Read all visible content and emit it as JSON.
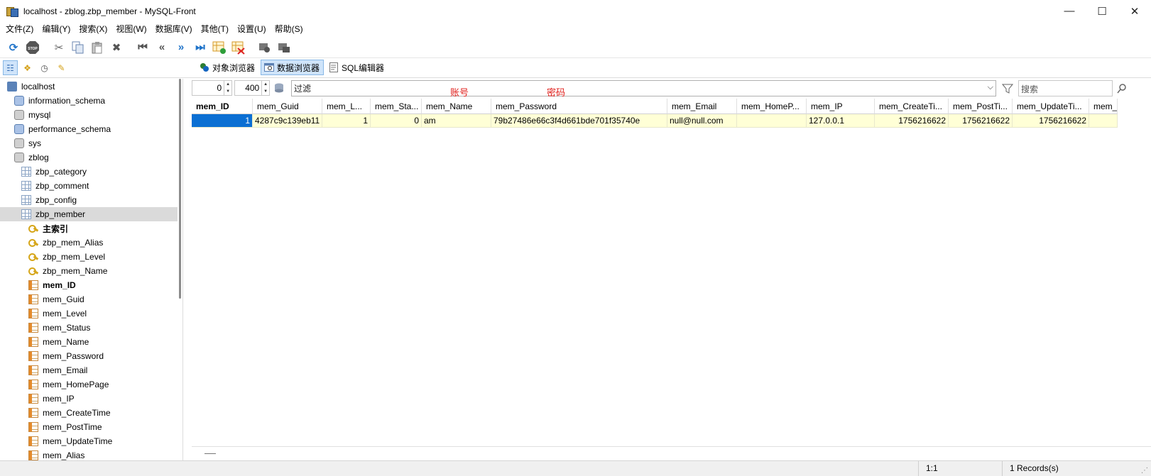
{
  "window": {
    "title": "localhost - zblog.zbp_member - MySQL-Front",
    "minimize": "—",
    "maximize": "☐",
    "close": "✕"
  },
  "menu": [
    "文件(Z)",
    "编辑(Y)",
    "搜索(X)",
    "视图(W)",
    "数据库(V)",
    "其他(T)",
    "设置(U)",
    "帮助(S)"
  ],
  "toolbar_icons": [
    "refresh-icon",
    "stop-icon",
    "cut-icon",
    "copy-icon",
    "paste-icon",
    "delete-icon",
    "first-record-icon",
    "previous-record-icon",
    "next-record-icon",
    "last-record-icon",
    "insert-record-icon",
    "delete-record-icon",
    "post-icon",
    "cancel-icon"
  ],
  "views": {
    "object_browser": "对象浏览器",
    "data_browser": "数据浏览器",
    "sql_editor": "SQL编辑器"
  },
  "tree": [
    {
      "label": "localhost",
      "icon": "server",
      "level": 0
    },
    {
      "label": "information_schema",
      "icon": "db-blue",
      "level": 1
    },
    {
      "label": "mysql",
      "icon": "db",
      "level": 1
    },
    {
      "label": "performance_schema",
      "icon": "db-blue",
      "level": 1
    },
    {
      "label": "sys",
      "icon": "db",
      "level": 1
    },
    {
      "label": "zblog",
      "icon": "db",
      "level": 1
    },
    {
      "label": "zbp_category",
      "icon": "table",
      "level": 2
    },
    {
      "label": "zbp_comment",
      "icon": "table",
      "level": 2
    },
    {
      "label": "zbp_config",
      "icon": "table",
      "level": 2
    },
    {
      "label": "zbp_member",
      "icon": "table",
      "level": 2,
      "selected": true
    },
    {
      "label": "主索引",
      "icon": "key",
      "level": 3,
      "bold": true
    },
    {
      "label": "zbp_mem_Alias",
      "icon": "key",
      "level": 3
    },
    {
      "label": "zbp_mem_Level",
      "icon": "key",
      "level": 3
    },
    {
      "label": "zbp_mem_Name",
      "icon": "key",
      "level": 3
    },
    {
      "label": "mem_ID",
      "icon": "col",
      "level": 3,
      "bold": true
    },
    {
      "label": "mem_Guid",
      "icon": "col",
      "level": 3
    },
    {
      "label": "mem_Level",
      "icon": "col",
      "level": 3
    },
    {
      "label": "mem_Status",
      "icon": "col",
      "level": 3
    },
    {
      "label": "mem_Name",
      "icon": "col",
      "level": 3
    },
    {
      "label": "mem_Password",
      "icon": "col",
      "level": 3
    },
    {
      "label": "mem_Email",
      "icon": "col",
      "level": 3
    },
    {
      "label": "mem_HomePage",
      "icon": "col",
      "level": 3
    },
    {
      "label": "mem_IP",
      "icon": "col",
      "level": 3
    },
    {
      "label": "mem_CreateTime",
      "icon": "col",
      "level": 3
    },
    {
      "label": "mem_PostTime",
      "icon": "col",
      "level": 3
    },
    {
      "label": "mem_UpdateTime",
      "icon": "col",
      "level": 3
    },
    {
      "label": "mem_Alias",
      "icon": "col",
      "level": 3
    }
  ],
  "filter": {
    "offset": "0",
    "limit": "400",
    "filter_placeholder": "过滤",
    "search_placeholder": "搜索"
  },
  "annotations": {
    "account": "账号",
    "password": "密码"
  },
  "grid": {
    "columns": [
      {
        "label": "mem_ID",
        "bold": true
      },
      {
        "label": "mem_Guid"
      },
      {
        "label": "mem_L..."
      },
      {
        "label": "mem_Sta..."
      },
      {
        "label": "mem_Name"
      },
      {
        "label": "mem_Password"
      },
      {
        "label": "mem_Email"
      },
      {
        "label": "mem_HomeP..."
      },
      {
        "label": "mem_IP"
      },
      {
        "label": "mem_CreateTi..."
      },
      {
        "label": "mem_PostTi..."
      },
      {
        "label": "mem_UpdateTi..."
      },
      {
        "label": "mem_..."
      }
    ],
    "rows": [
      [
        "1",
        "4287c9c139eb11",
        "1",
        "0",
        "am",
        "79b27486e66c3f4d661bde701f35740e",
        "null@null.com",
        "",
        "127.0.0.1",
        "1756216622",
        "1756216622",
        "1756216622",
        ""
      ]
    ]
  },
  "status": {
    "position": "1:1",
    "records": "1 Records(s)"
  }
}
